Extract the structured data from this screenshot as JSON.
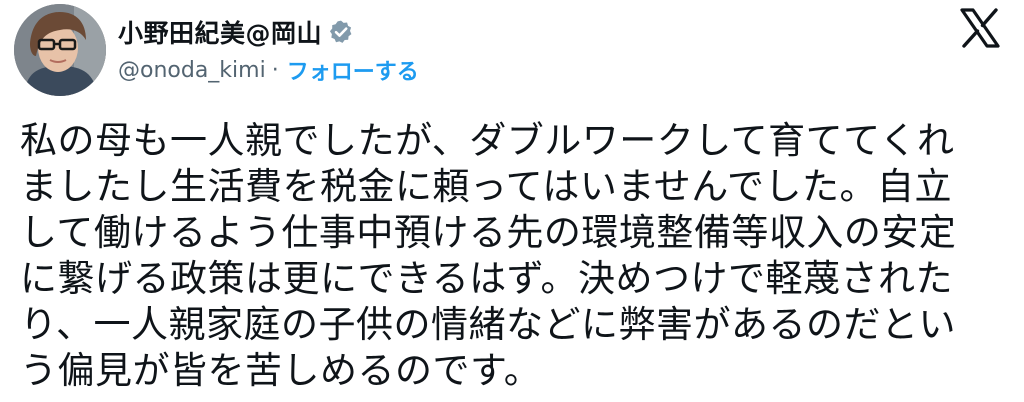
{
  "author": {
    "display_name": "小野田紀美@岡山",
    "handle": "@onoda_kimi",
    "separator": "·",
    "follow_label": "フォローする",
    "verified": true
  },
  "platform": {
    "logo": "x-logo-icon"
  },
  "tweet": {
    "lines": [
      "私の母も一人親でしたが、ダブルワークして育ててくれ",
      "ましたし生活費を税金に頼ってはいませんでした。自立",
      "して働けるよう仕事中預ける先の環境整備等収入の安定",
      "に繋げる政策は更にできるはず。決めつけで軽蔑された",
      "り、一人親家庭の子供の情緒などに弊害があるのだとい",
      "う偏見が皆を苦しめるのです。"
    ]
  },
  "colors": {
    "text": "#0f1419",
    "secondary": "#536471",
    "accent": "#1d9bf0",
    "verified_badge": "#829aab"
  }
}
